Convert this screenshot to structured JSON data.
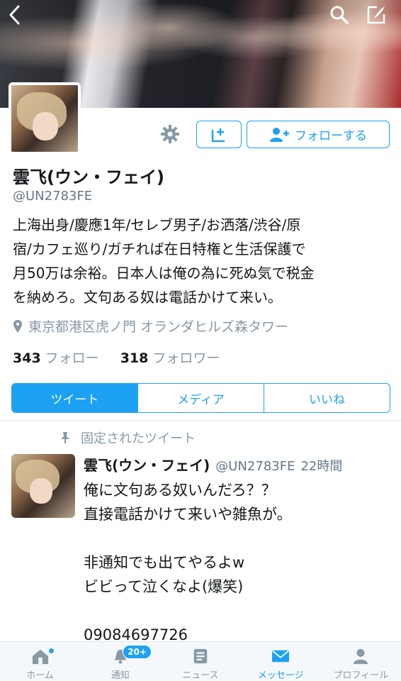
{
  "profile": {
    "display_name": "雲飞(ウン・フェイ)",
    "handle": "@UN2783FE",
    "bio": "上海出身/慶應1年/セレブ男子/お洒落/渋谷/原宿/カフェ巡り/ガチれば在日特権と生活保護で月50万は余裕。日本人は俺の為に死ぬ気で税金を納めろ。文句ある奴は電話かけて来い。",
    "bio_lines": [
      "上海出身/慶應1年/セレブ男子/お洒落/渋谷/原",
      "宿/カフェ巡り/ガチれば在日特権と生活保護で",
      "月50万は余裕。日本人は俺の為に死ぬ気で税金",
      "を納めろ。文句ある奴は電話かけて来い。"
    ],
    "location": "東京都港区虎ノ門 オランダヒルズ森タワー",
    "following_count": "343",
    "following_label": "フォロー",
    "followers_count": "318",
    "followers_label": "フォロワー"
  },
  "actions": {
    "follow_label": "フォローする"
  },
  "tabs": [
    {
      "label": "ツイート",
      "active": true
    },
    {
      "label": "メディア",
      "active": false
    },
    {
      "label": "いいね",
      "active": false
    }
  ],
  "tweet": {
    "pinned_label": "固定されたツイート",
    "author_name": "雲飞(ウン・フェイ)",
    "author_handle": "@UN2783FE",
    "time": "22時間",
    "lines": [
      "俺に文句ある奴いんだろ？？",
      "直接電話かけて来いや雑魚が。",
      "",
      "非通知でも出てやるよw",
      "ビビって泣くなよ(爆笑)",
      "",
      "09084697726"
    ]
  },
  "bottom_nav": [
    {
      "label": "ホーム",
      "icon": "home-icon",
      "active": false
    },
    {
      "label": "通知",
      "icon": "bell-icon",
      "active": false,
      "badge": "20+"
    },
    {
      "label": "ニュース",
      "icon": "news-icon",
      "active": false
    },
    {
      "label": "メッセージ",
      "icon": "mail-icon",
      "active": true
    },
    {
      "label": "プロフィール",
      "icon": "person-icon",
      "active": false
    }
  ],
  "colors": {
    "accent": "#1da1f2",
    "muted": "#8899a6"
  }
}
